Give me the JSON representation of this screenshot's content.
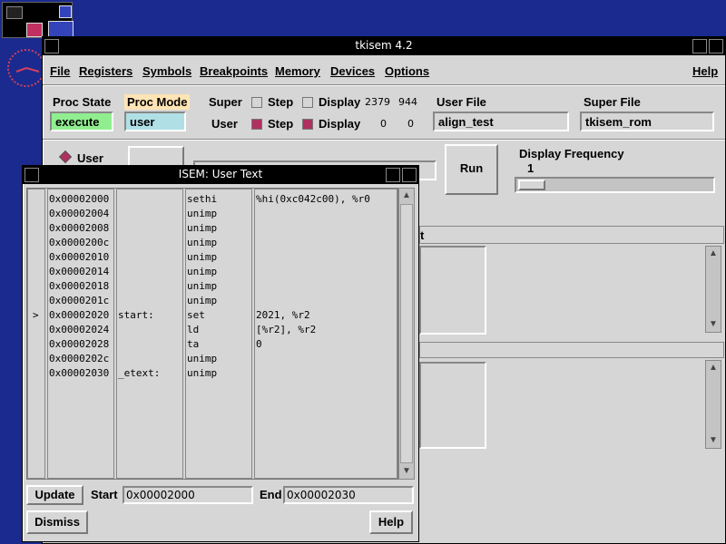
{
  "main": {
    "title": "tkisem 4.2",
    "menu": [
      "File",
      "Registers",
      "Symbols",
      "Breakpoints",
      "Memory",
      "Devices",
      "Options",
      "Help"
    ],
    "proc_state_label": "Proc State",
    "proc_mode_label": "Proc Mode",
    "proc_state_value": "execute",
    "proc_mode_value": "user",
    "super_label": "Super",
    "user_label": "User",
    "step_label": "Step",
    "display_label": "Display",
    "super_counts": [
      "2379",
      "944"
    ],
    "user_counts": [
      "0",
      "0"
    ],
    "user_file_label": "User File",
    "user_file_value": "align_test",
    "super_file_label": "Super File",
    "super_file_value": "tkisem_rom",
    "radio_user": "User",
    "run_label": "Run",
    "display_freq_label": "Display Frequency",
    "display_freq_value": "1",
    "panel_hint": "t"
  },
  "ut": {
    "title": "ISEM: User Text",
    "rows": [
      {
        "addr": "0x00002000",
        "label": "",
        "op": "sethi",
        "args": "%hi(0xc042c00), %r0"
      },
      {
        "addr": "0x00002004",
        "label": "",
        "op": "unimp",
        "args": ""
      },
      {
        "addr": "0x00002008",
        "label": "",
        "op": "unimp",
        "args": ""
      },
      {
        "addr": "0x0000200c",
        "label": "",
        "op": "unimp",
        "args": ""
      },
      {
        "addr": "0x00002010",
        "label": "",
        "op": "unimp",
        "args": ""
      },
      {
        "addr": "0x00002014",
        "label": "",
        "op": "unimp",
        "args": ""
      },
      {
        "addr": "0x00002018",
        "label": "",
        "op": "unimp",
        "args": ""
      },
      {
        "addr": "0x0000201c",
        "label": "",
        "op": "unimp",
        "args": ""
      },
      {
        "addr": "0x00002020",
        "label": "start:",
        "op": "set",
        "args": "2021, %r2"
      },
      {
        "addr": "0x00002024",
        "label": "",
        "op": "ld",
        "args": "[%r2], %r2"
      },
      {
        "addr": "0x00002028",
        "label": "",
        "op": "ta",
        "args": "0"
      },
      {
        "addr": "0x0000202c",
        "label": "",
        "op": "unimp",
        "args": ""
      },
      {
        "addr": "0x00002030",
        "label": "_etext:",
        "op": "unimp",
        "args": ""
      }
    ],
    "pc_marker": ">",
    "update": "Update",
    "start_label": "Start",
    "start_value": "0x00002000",
    "end_label": "End",
    "end_value": "0x00002030",
    "dismiss": "Dismiss",
    "help": "Help"
  }
}
